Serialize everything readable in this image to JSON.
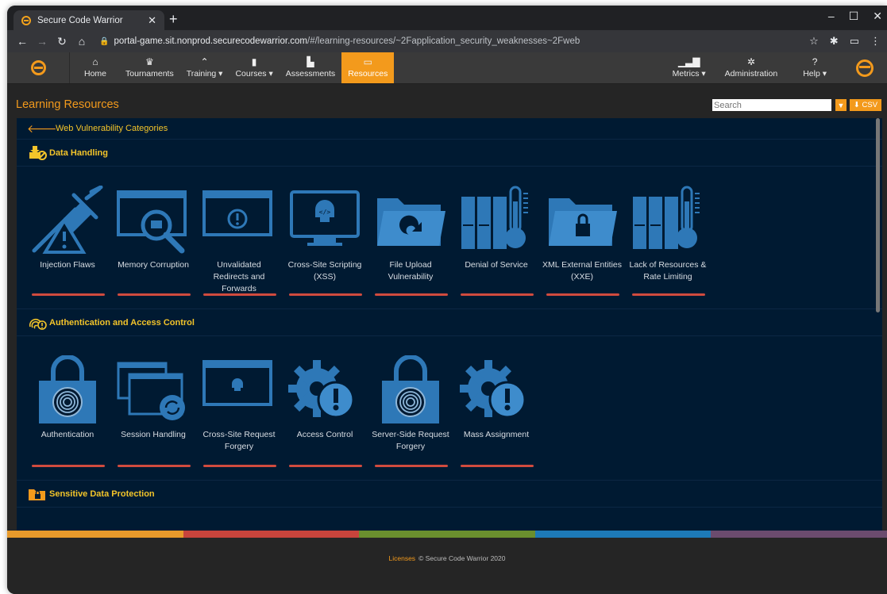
{
  "browser": {
    "tab_title": "Secure Code Warrior",
    "url_host": "portal-game.sit.nonprod.securecodewarrior.com",
    "url_path": "/#/learning-resources/~2Fapplication_security_weaknesses~2Fweb"
  },
  "nav": {
    "items": [
      {
        "label": "Home",
        "icon": "home-icon"
      },
      {
        "label": "Tournaments",
        "icon": "trophy-icon"
      },
      {
        "label": "Training ▾",
        "icon": "graduation-cap-icon"
      },
      {
        "label": "Courses ▾",
        "icon": "book-icon"
      },
      {
        "label": "Assessments",
        "icon": "document-icon"
      },
      {
        "label": "Resources",
        "icon": "presentation-icon",
        "active": true
      }
    ],
    "right_items": [
      {
        "label": "Metrics ▾",
        "icon": "bar-chart-icon"
      },
      {
        "label": "Administration",
        "icon": "gear-icon"
      },
      {
        "label": "Help ▾",
        "icon": "question-circle-icon"
      }
    ]
  },
  "page": {
    "title": "Learning Resources",
    "search_placeholder": "Search",
    "csv_label": "CSV",
    "breadcrumb": "Web Vulnerability Categories"
  },
  "sections": [
    {
      "title": "Data Handling",
      "tiles": [
        {
          "name": "Injection Flaws",
          "icon": "syringe-icon"
        },
        {
          "name": "Memory Corruption",
          "icon": "window-magnifier-icon"
        },
        {
          "name": "Unvalidated Redirects and Forwards",
          "icon": "window-warning-icon"
        },
        {
          "name": "Cross-Site Scripting (XSS)",
          "icon": "monitor-skull-icon"
        },
        {
          "name": "File Upload Vulnerability",
          "icon": "folder-upload-icon"
        },
        {
          "name": "Denial of Service",
          "icon": "servers-thermometer-icon"
        },
        {
          "name": "XML External Entities (XXE)",
          "icon": "folder-lock-icon"
        },
        {
          "name": "Lack of Resources & Rate Limiting",
          "icon": "servers-thermometer-icon"
        }
      ]
    },
    {
      "title": "Authentication and Access Control",
      "tiles": [
        {
          "name": "Authentication",
          "icon": "padlock-fingerprint-icon"
        },
        {
          "name": "Session Handling",
          "icon": "windows-refresh-icon"
        },
        {
          "name": "Cross-Site Request Forgery",
          "icon": "window-skull-icon"
        },
        {
          "name": "Access Control",
          "icon": "gear-warning-icon"
        },
        {
          "name": "Server-Side Request Forgery",
          "icon": "padlock-fingerprint-icon"
        },
        {
          "name": "Mass Assignment",
          "icon": "gear-warning-icon"
        }
      ]
    },
    {
      "title": "Sensitive Data Protection",
      "tiles": []
    }
  ],
  "colors": {
    "accent": "#f39a1c",
    "icon_blue": "#2e78b7",
    "content_bg": "#001a32",
    "bar_red": "#d14b3e",
    "stripe": [
      "#e89a2b",
      "#c8443c",
      "#6a8f2e",
      "#1d7ab8",
      "#6b4b6e"
    ]
  },
  "footer": {
    "link": "Licenses",
    "text": "© Secure Code Warrior 2020"
  }
}
